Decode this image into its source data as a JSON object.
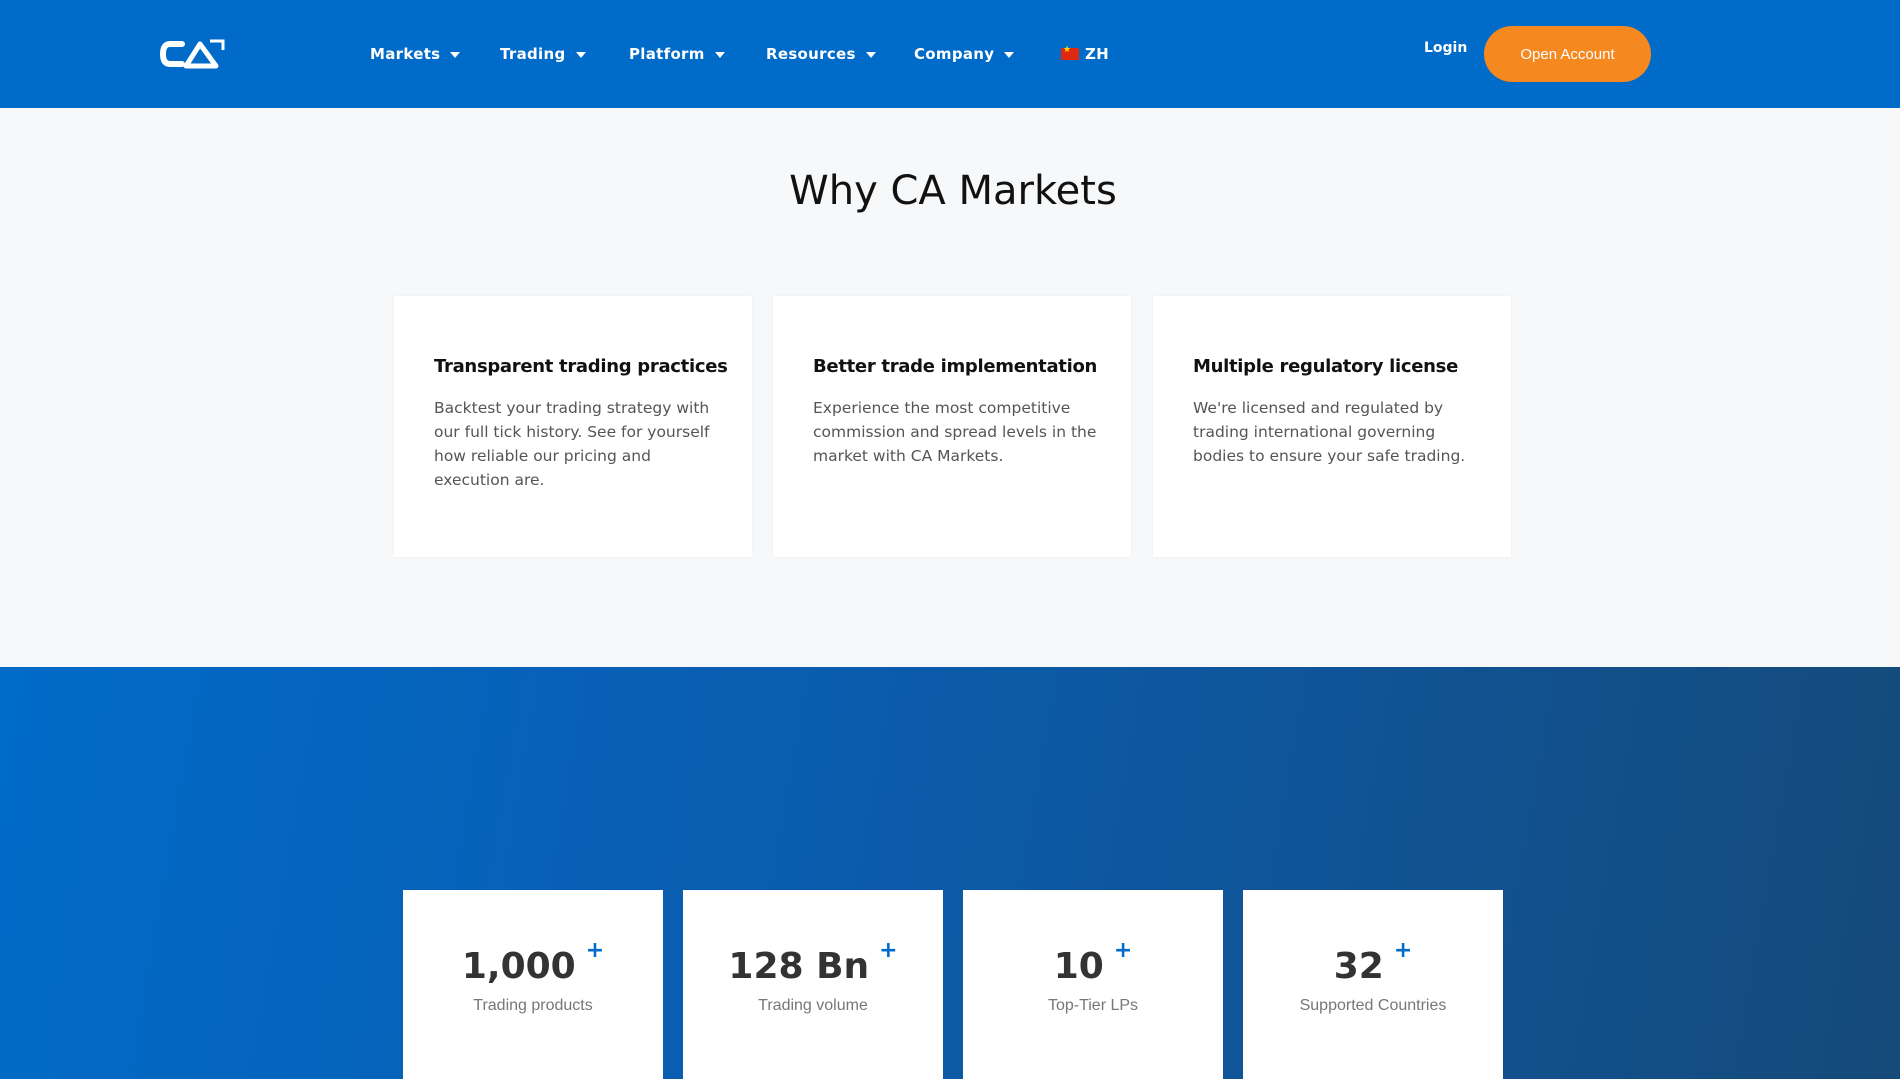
{
  "header": {
    "logo_text": "CA",
    "nav": [
      {
        "label": "Markets"
      },
      {
        "label": "Trading"
      },
      {
        "label": "Platform"
      },
      {
        "label": "Resources"
      },
      {
        "label": "Company"
      }
    ],
    "language": "ZH",
    "login_label": "Login",
    "cta_label": "Open Account",
    "colors": {
      "bar": "#006bc9",
      "cta": "#f5891f"
    }
  },
  "why": {
    "title": "Why CA Markets",
    "cards": [
      {
        "title": "Transparent trading practices",
        "text": "Backtest your trading strategy with our full tick history. See for yourself how reliable our pricing and execution are."
      },
      {
        "title": "Better trade implementation",
        "text": "Experience the most competitive commission and spread levels in the market with CA Markets."
      },
      {
        "title": "Multiple regulatory license",
        "text": "We're licensed and regulated by trading international governing bodies to ensure your safe trading."
      }
    ]
  },
  "stats": [
    {
      "value": "1,000",
      "suffix": "+",
      "label": "Trading products"
    },
    {
      "value": "128 Bn",
      "suffix": "+",
      "label": "Trading volume"
    },
    {
      "value": "10",
      "suffix": "+",
      "label": "Top-Tier LPs"
    },
    {
      "value": "32",
      "suffix": "+",
      "label": "Supported Countries"
    }
  ]
}
